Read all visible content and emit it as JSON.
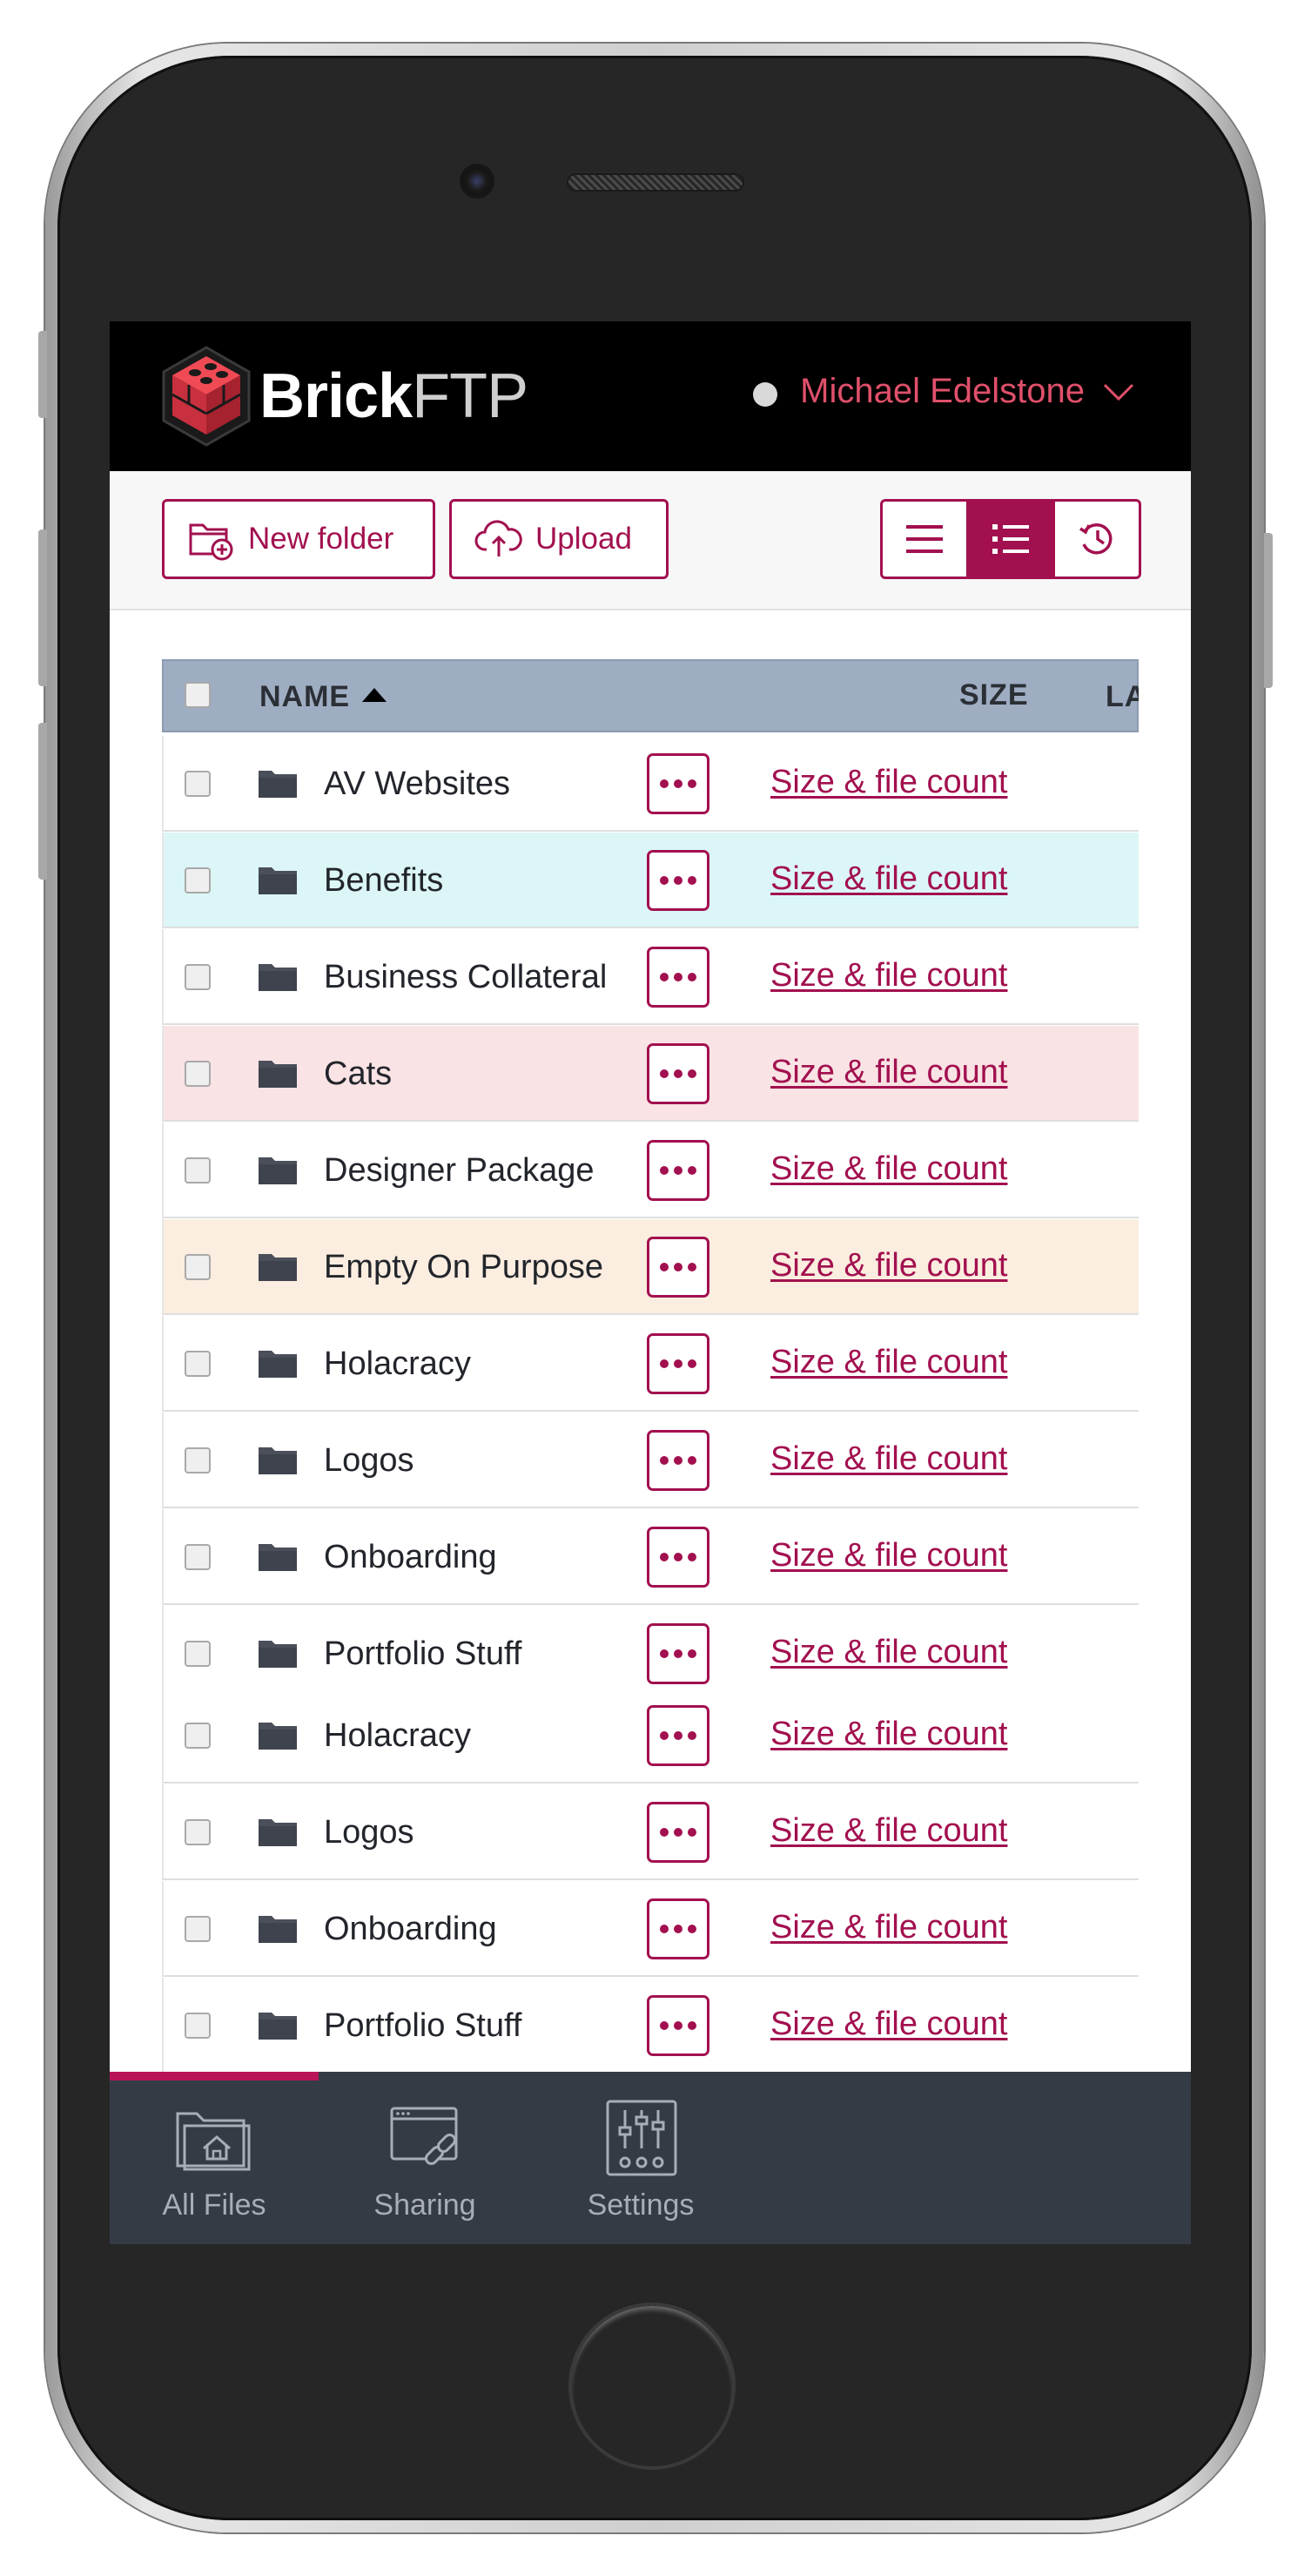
{
  "header": {
    "logo_brick": "Brick",
    "logo_ftp": "FTP",
    "user_name": "Michael Edelstone",
    "status_icon": "status-dot-icon",
    "menu_icon": "chevron-down-icon"
  },
  "toolbar": {
    "new_folder_label": "New folder",
    "upload_label": "Upload",
    "views": [
      "list-view-icon",
      "detail-list-view-icon",
      "history-view-icon"
    ],
    "active_view": 1
  },
  "table": {
    "columns": {
      "name": "NAME",
      "size": "SIZE",
      "last": "LA"
    },
    "sort": "ascending",
    "rows": [
      {
        "name": "AV Websites",
        "size_link": "Size & file count",
        "color": "#ffffff"
      },
      {
        "name": "Benefits",
        "size_link": "Size & file count",
        "color": "#dcf6f7"
      },
      {
        "name": "Business Collateral",
        "size_link": "Size & file count",
        "color": "#ffffff"
      },
      {
        "name": "Cats",
        "size_link": "Size & file count",
        "color": "#f9e3e4"
      },
      {
        "name": "Designer Package",
        "size_link": "Size & file count",
        "color": "#ffffff"
      },
      {
        "name": "Empty On Purpose",
        "size_link": "Size & file count",
        "color": "#fbeddf"
      },
      {
        "name": "Holacracy",
        "size_link": "Size & file count",
        "color": "#ffffff"
      },
      {
        "name": "Logos",
        "size_link": "Size & file count",
        "color": "#ffffff"
      },
      {
        "name": "Onboarding",
        "size_link": "Size & file count",
        "color": "#ffffff"
      },
      {
        "name": "Portfolio Stuff",
        "size_link": "Size & file count",
        "color": "#ffffff"
      },
      {
        "name": "Holacracy",
        "size_link": "Size & file count",
        "color": "#ffffff"
      },
      {
        "name": "Logos",
        "size_link": "Size & file count",
        "color": "#ffffff"
      },
      {
        "name": "Onboarding",
        "size_link": "Size & file count",
        "color": "#ffffff"
      },
      {
        "name": "Portfolio Stuff",
        "size_link": "Size & file count",
        "color": "#ffffff"
      }
    ]
  },
  "bottom_nav": {
    "items": [
      {
        "label": "All Files",
        "icon": "home-folder-icon"
      },
      {
        "label": "Sharing",
        "icon": "share-link-icon"
      },
      {
        "label": "Settings",
        "icon": "sliders-icon"
      }
    ],
    "active": 0
  },
  "colors": {
    "brand": "#a2104f",
    "header_bg": "#000000",
    "user_name": "#e0506a",
    "table_header": "#9fadc2",
    "nav_bg": "#353b45",
    "nav_active": "#b81457"
  }
}
